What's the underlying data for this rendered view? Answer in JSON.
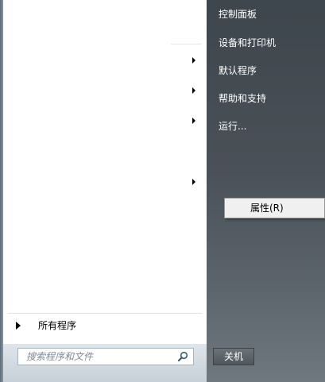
{
  "right_pane": {
    "items": [
      {
        "label": "控制面板"
      },
      {
        "label": "设备和打印机"
      },
      {
        "label": "默认程序"
      },
      {
        "label": "帮助和支持"
      },
      {
        "label": "运行..."
      }
    ]
  },
  "left_pane": {
    "all_programs_label": "所有程序"
  },
  "search": {
    "placeholder": "搜索程序和文件"
  },
  "shutdown": {
    "label": "关机"
  },
  "context_menu": {
    "items": [
      {
        "label": "属性(R)"
      }
    ]
  }
}
